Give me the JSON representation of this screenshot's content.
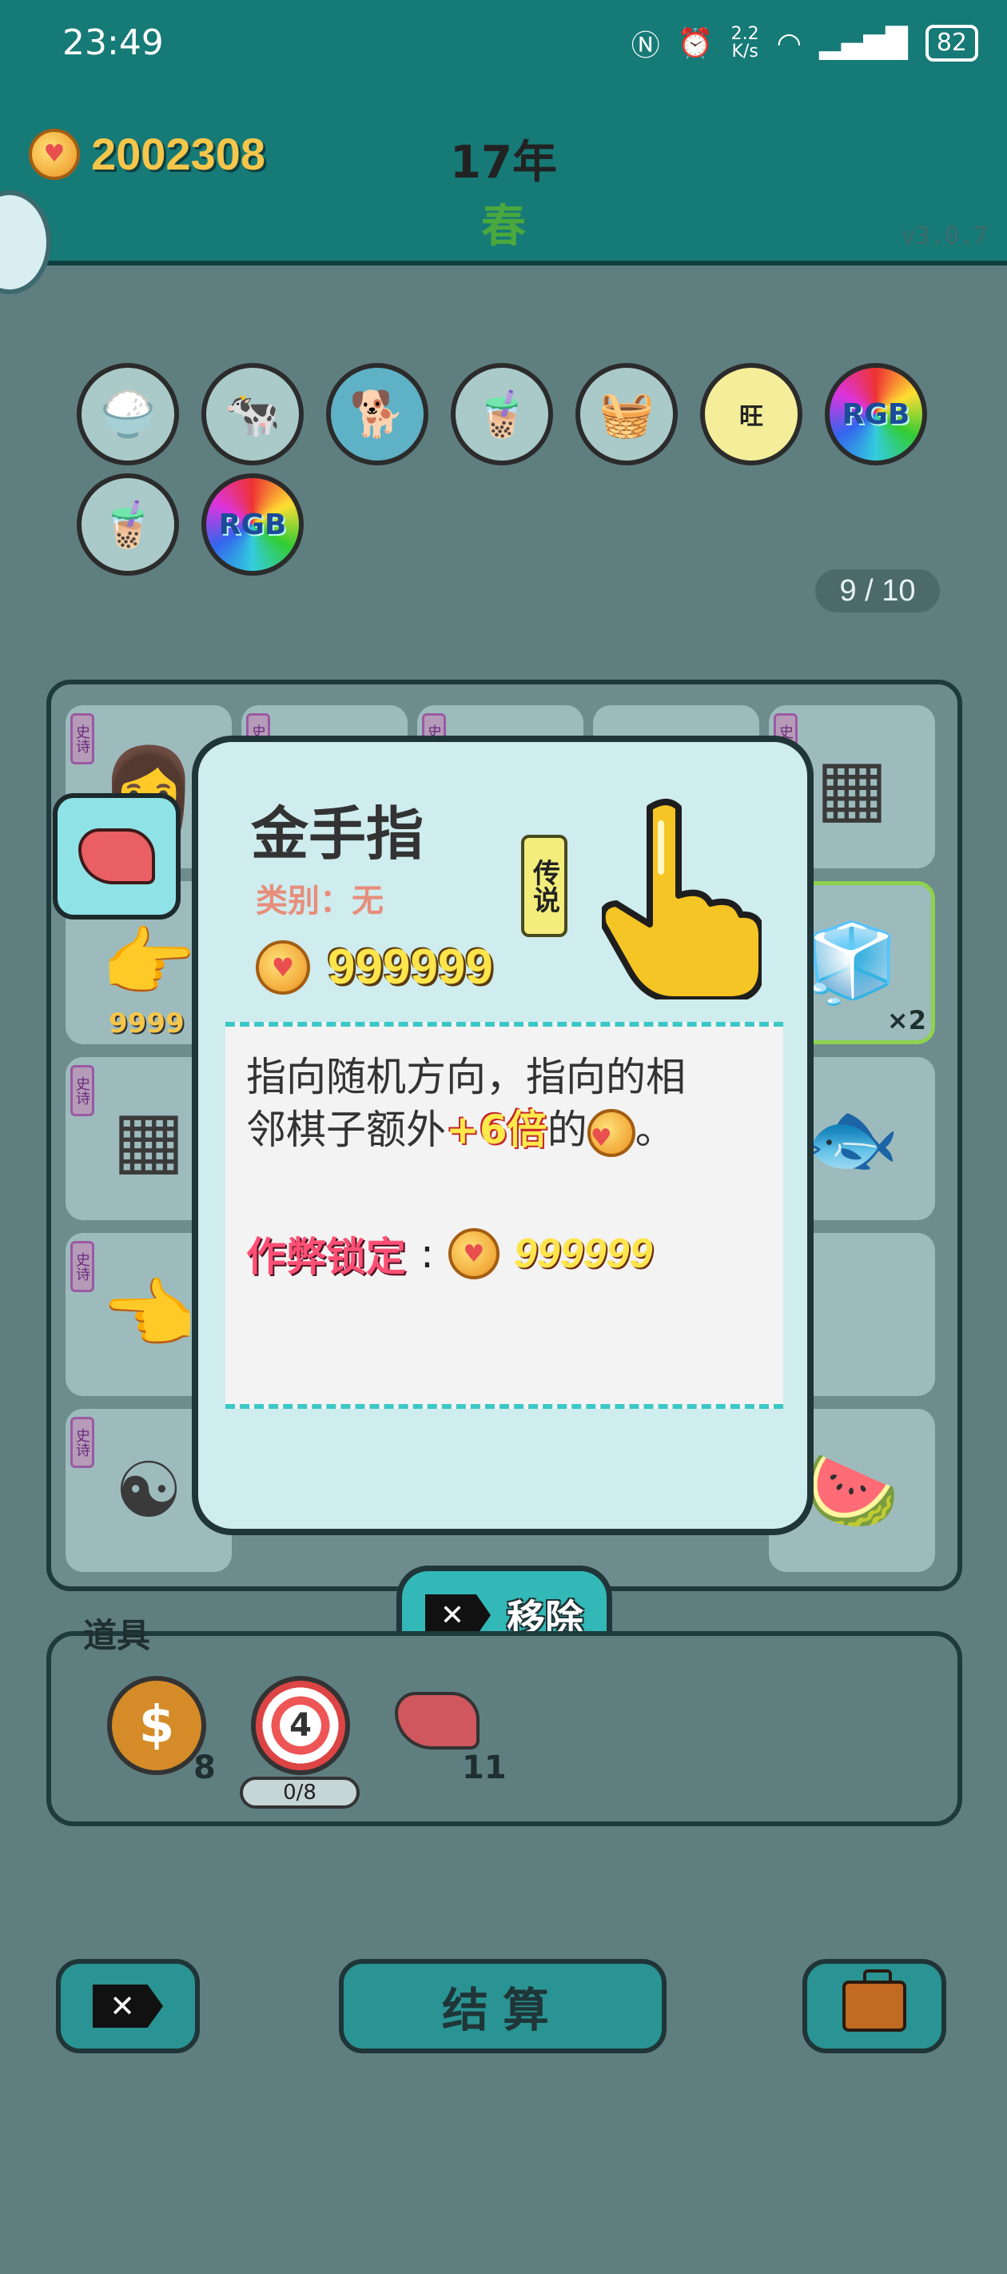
{
  "status_bar": {
    "time": "23:49",
    "net_speed_top": "2.2",
    "net_speed_bottom": "K/s",
    "battery": "82"
  },
  "header": {
    "coins": "2002308",
    "year": "17年",
    "season": "春",
    "version": "v3.0.7"
  },
  "owned_items": {
    "count_text": "9 / 10",
    "rgb_label": "RGB",
    "wang_label": "旺"
  },
  "board": {
    "tag_text": "史诗",
    "cell_value_partial": "9999",
    "multiplier": "×2"
  },
  "tooltip": {
    "name": "金手指",
    "category": "类别：无",
    "rarity": "传说",
    "price": "999999",
    "desc_line1": "指向随机方向，指向的相",
    "desc_line2_a": "邻棋子额外",
    "desc_line2_bonus": "+6倍",
    "desc_line2_b": "的",
    "desc_line2_end": "。",
    "cheat_label": "作弊锁定",
    "cheat_colon": ":",
    "cheat_value": "999999"
  },
  "remove_button": {
    "label": "移除"
  },
  "tools": {
    "label": "道具",
    "dollar_count": "8",
    "target_level": "4",
    "target_progress": "0/8",
    "liver_count": "11"
  },
  "bottom": {
    "settle_label": "结算"
  },
  "colors": {
    "teal": "#167a77",
    "accent": "#33b8b8",
    "coin_gold": "#f6c64a"
  }
}
